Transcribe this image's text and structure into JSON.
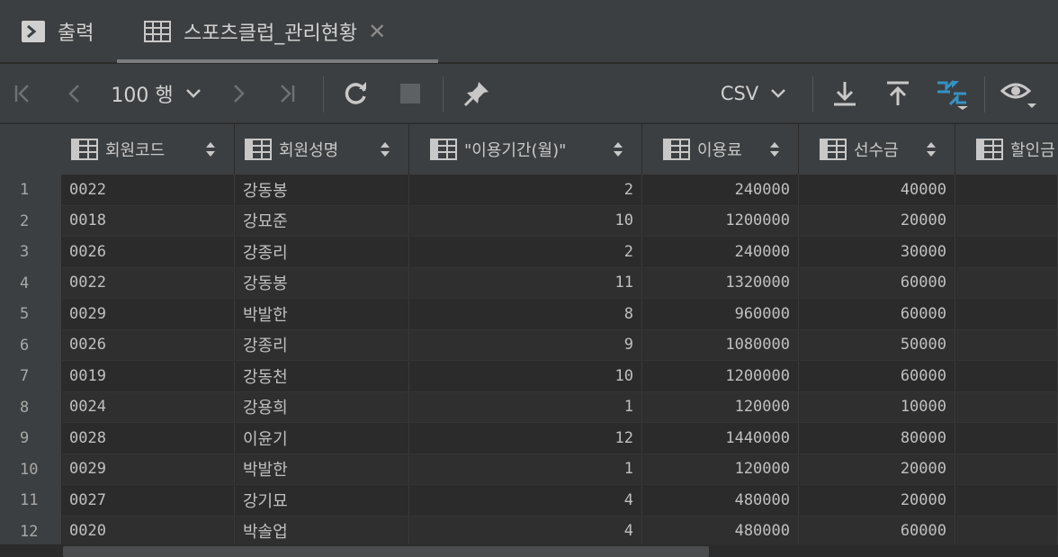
{
  "tabs": [
    {
      "label": "출력",
      "icon": "console-icon"
    },
    {
      "label": "스포츠클럽_관리현황",
      "icon": "table-icon",
      "active": true
    }
  ],
  "toolbar": {
    "rows_label": "100 행",
    "export_format": "CSV"
  },
  "colors": {
    "accent": "#3592c4"
  },
  "table": {
    "columns": [
      "회원코드",
      "회원성명",
      "\"이용기간(월)\"",
      "이용료",
      "선수금",
      "할인금"
    ],
    "rows": [
      {
        "n": "1",
        "code": "0022",
        "name": "강동봉",
        "period": "2",
        "fee": "240000",
        "advance": "40000"
      },
      {
        "n": "2",
        "code": "0018",
        "name": "강묘준",
        "period": "10",
        "fee": "1200000",
        "advance": "20000"
      },
      {
        "n": "3",
        "code": "0026",
        "name": "강종리",
        "period": "2",
        "fee": "240000",
        "advance": "30000"
      },
      {
        "n": "4",
        "code": "0022",
        "name": "강동봉",
        "period": "11",
        "fee": "1320000",
        "advance": "60000"
      },
      {
        "n": "5",
        "code": "0029",
        "name": "박발한",
        "period": "8",
        "fee": "960000",
        "advance": "60000"
      },
      {
        "n": "6",
        "code": "0026",
        "name": "강종리",
        "period": "9",
        "fee": "1080000",
        "advance": "50000"
      },
      {
        "n": "7",
        "code": "0019",
        "name": "강동천",
        "period": "10",
        "fee": "1200000",
        "advance": "60000"
      },
      {
        "n": "8",
        "code": "0024",
        "name": "강용희",
        "period": "1",
        "fee": "120000",
        "advance": "10000"
      },
      {
        "n": "9",
        "code": "0028",
        "name": "이윤기",
        "period": "12",
        "fee": "1440000",
        "advance": "80000"
      },
      {
        "n": "10",
        "code": "0029",
        "name": "박발한",
        "period": "1",
        "fee": "120000",
        "advance": "20000"
      },
      {
        "n": "11",
        "code": "0027",
        "name": "강기묘",
        "period": "4",
        "fee": "480000",
        "advance": "20000"
      },
      {
        "n": "12",
        "code": "0020",
        "name": "박솔업",
        "period": "4",
        "fee": "480000",
        "advance": "60000"
      }
    ]
  }
}
